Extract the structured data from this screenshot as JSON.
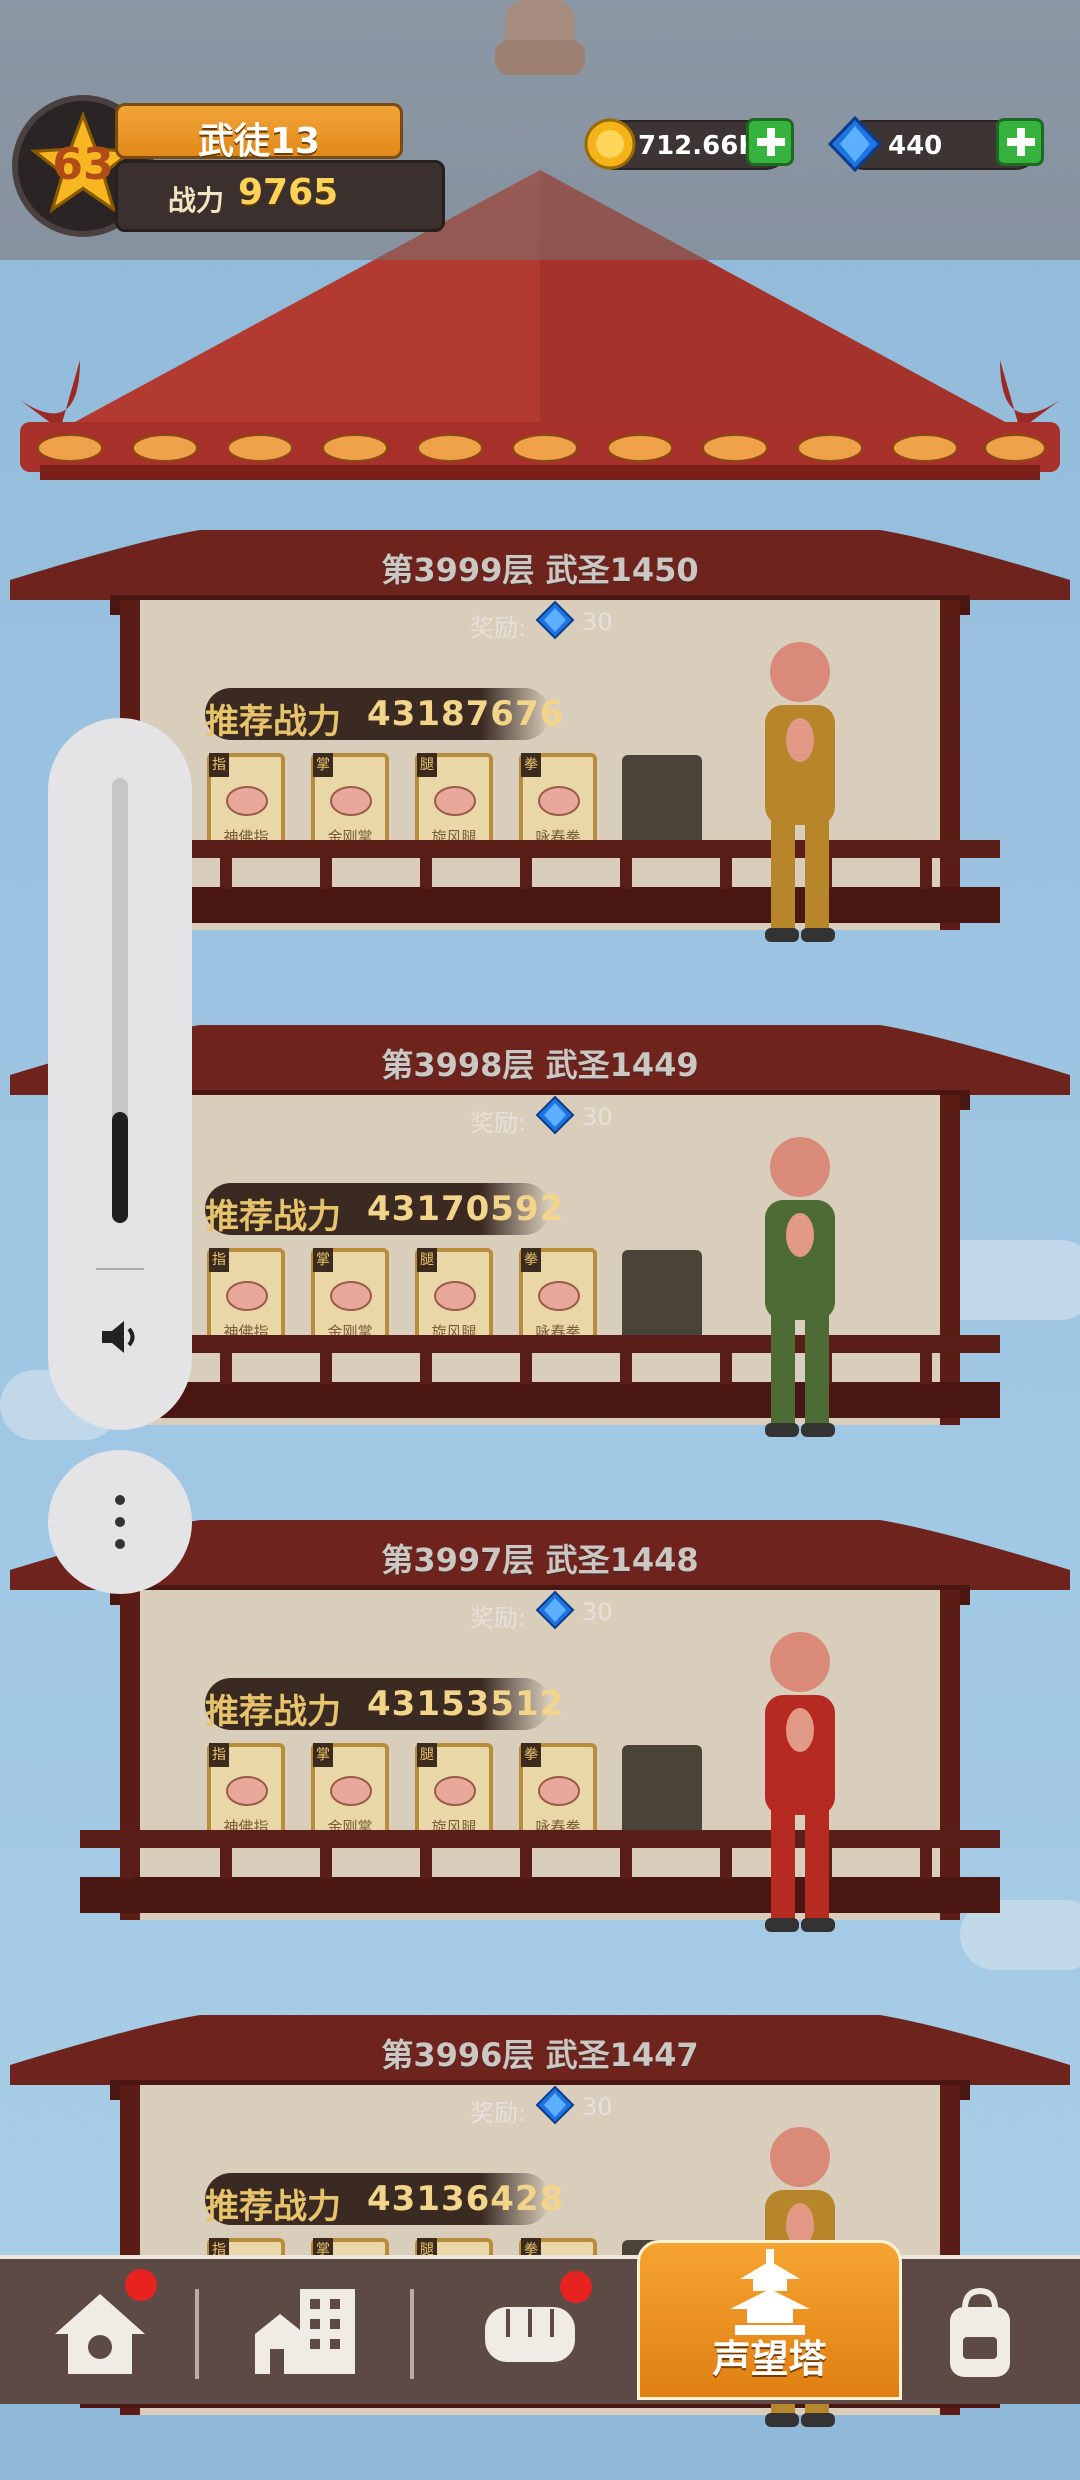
{
  "player": {
    "level": "63",
    "name": "武徒13",
    "power_label": "战力",
    "power_value": "9765"
  },
  "currencies": [
    {
      "name": "gold",
      "icon": "gold-coin-icon",
      "value": "712.66K"
    },
    {
      "name": "gems",
      "icon": "blue-gem-icon",
      "value": "440"
    }
  ],
  "floors": [
    {
      "title": "第3999层 武圣1450",
      "reward_label": "奖励:",
      "reward_value": "30",
      "rec_label": "推荐战力",
      "rec_value": "43187676",
      "monk_color": "#b8862a"
    },
    {
      "title": "第3998层 武圣1449",
      "reward_label": "奖励:",
      "reward_value": "30",
      "rec_label": "推荐战力",
      "rec_value": "43170592",
      "monk_color": "#4d6b34"
    },
    {
      "title": "第3997层 武圣1448",
      "reward_label": "奖励:",
      "reward_value": "30",
      "rec_label": "推荐战力",
      "rec_value": "43153512",
      "monk_color": "#b62a22"
    },
    {
      "title": "第3996层 武圣1447",
      "reward_label": "奖励:",
      "reward_value": "30",
      "rec_label": "推荐战力",
      "rec_value": "43136428",
      "monk_color": "#b8862a"
    }
  ],
  "skills": [
    {
      "tag": "指",
      "name": "神佛指"
    },
    {
      "tag": "掌",
      "name": "金刚掌"
    },
    {
      "tag": "腿",
      "name": "旋风腿"
    },
    {
      "tag": "拳",
      "name": "咏春拳"
    }
  ],
  "volume": {
    "level_fraction": 0.25
  },
  "nav": {
    "items": [
      "home-icon",
      "buildings-icon",
      "fist-icon",
      "tower-icon",
      "backpack-icon"
    ],
    "active_label": "声望塔"
  },
  "colors": {
    "accent": "#e8891a",
    "roof": "#a8302a",
    "notification": "#e8231f"
  }
}
